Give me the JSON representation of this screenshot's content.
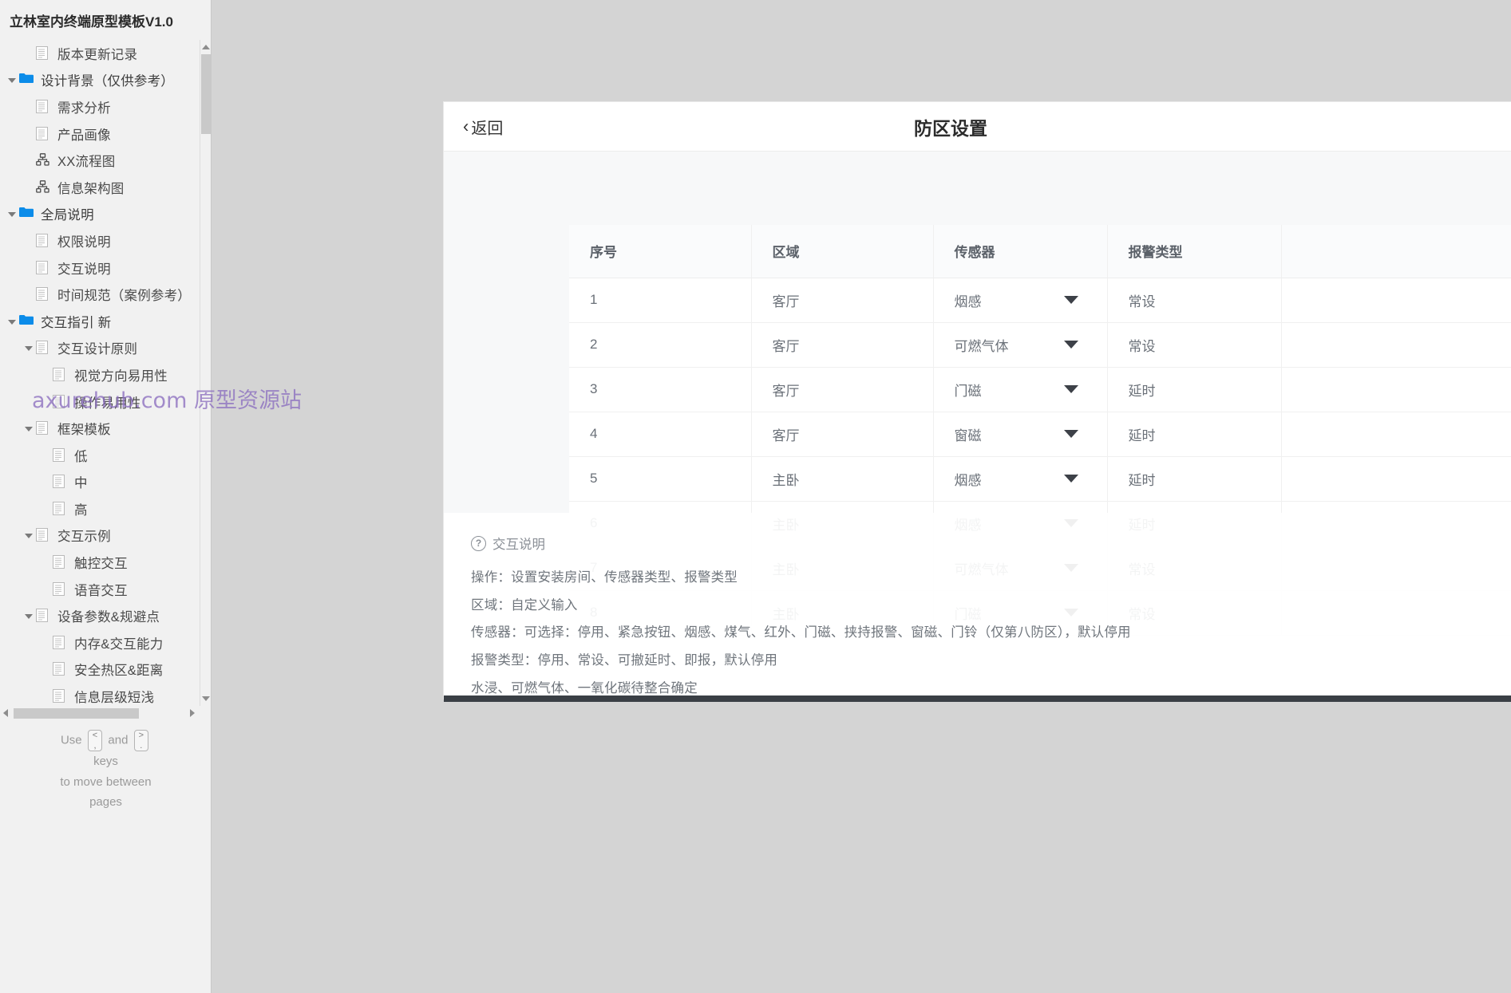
{
  "sidebar": {
    "title": "立林室内终端原型模板V1.0",
    "tree": [
      {
        "label": "版本更新记录",
        "icon": "page-icon",
        "indent": 1,
        "arrow": "none"
      },
      {
        "label": "设计背景（仅供参考）",
        "icon": "folder-icon",
        "indent": 0,
        "arrow": "open"
      },
      {
        "label": "需求分析",
        "icon": "page-icon",
        "indent": 1,
        "arrow": "none"
      },
      {
        "label": "产品画像",
        "icon": "page-icon",
        "indent": 1,
        "arrow": "none"
      },
      {
        "label": "XX流程图",
        "icon": "flow-icon",
        "indent": 1,
        "arrow": "none"
      },
      {
        "label": "信息架构图",
        "icon": "flow-icon",
        "indent": 1,
        "arrow": "none"
      },
      {
        "label": "全局说明",
        "icon": "folder-icon",
        "indent": 0,
        "arrow": "open"
      },
      {
        "label": "权限说明",
        "icon": "page-icon",
        "indent": 1,
        "arrow": "none"
      },
      {
        "label": "交互说明",
        "icon": "page-icon",
        "indent": 1,
        "arrow": "none"
      },
      {
        "label": "时间规范（案例参考）",
        "icon": "page-icon",
        "indent": 1,
        "arrow": "none"
      },
      {
        "label": "交互指引 新",
        "icon": "folder-icon",
        "indent": 0,
        "arrow": "open"
      },
      {
        "label": "交互设计原则",
        "icon": "page-icon",
        "indent": 1,
        "arrow": "open"
      },
      {
        "label": "视觉方向易用性",
        "icon": "page-icon",
        "indent": 2,
        "arrow": "none"
      },
      {
        "label": "操作易用性",
        "icon": "page-icon",
        "indent": 2,
        "arrow": "none"
      },
      {
        "label": "框架模板",
        "icon": "page-icon",
        "indent": 1,
        "arrow": "open"
      },
      {
        "label": "低",
        "icon": "page-icon",
        "indent": 2,
        "arrow": "none"
      },
      {
        "label": "中",
        "icon": "page-icon",
        "indent": 2,
        "arrow": "none"
      },
      {
        "label": "高",
        "icon": "page-icon",
        "indent": 2,
        "arrow": "none"
      },
      {
        "label": "交互示例",
        "icon": "page-icon",
        "indent": 1,
        "arrow": "open"
      },
      {
        "label": "触控交互",
        "icon": "page-icon",
        "indent": 2,
        "arrow": "none"
      },
      {
        "label": "语音交互",
        "icon": "page-icon",
        "indent": 2,
        "arrow": "none"
      },
      {
        "label": "设备参数&规避点",
        "icon": "page-icon",
        "indent": 1,
        "arrow": "open"
      },
      {
        "label": "内存&交互能力",
        "icon": "page-icon",
        "indent": 2,
        "arrow": "none"
      },
      {
        "label": "安全热区&距离",
        "icon": "page-icon",
        "indent": 2,
        "arrow": "none"
      },
      {
        "label": "信息层级短浅",
        "icon": "page-icon",
        "indent": 2,
        "arrow": "none"
      }
    ],
    "page_hint": {
      "use": "Use",
      "key_prev": "<",
      "key_prev_sub": ",",
      "and": "and",
      "key_next": ">",
      "key_next_sub": ".",
      "keys_word": "keys",
      "line2": "to move between",
      "line3": "pages"
    }
  },
  "watermark": "axurehub.com 原型资源站",
  "device": {
    "topbar": {
      "back_label": "返回",
      "back_chevron": "‹",
      "title": "防区设置"
    },
    "table": {
      "columns": [
        "序号",
        "区域",
        "传感器",
        "报警类型"
      ],
      "rows": [
        {
          "idx": "1",
          "area": "客厅",
          "sensor": "烟感",
          "alarm": "常设"
        },
        {
          "idx": "2",
          "area": "客厅",
          "sensor": "可燃气体",
          "alarm": "常设"
        },
        {
          "idx": "3",
          "area": "客厅",
          "sensor": "门磁",
          "alarm": "延时"
        },
        {
          "idx": "4",
          "area": "客厅",
          "sensor": "窗磁",
          "alarm": "延时"
        },
        {
          "idx": "5",
          "area": "主卧",
          "sensor": "烟感",
          "alarm": "延时"
        },
        {
          "idx": "6",
          "area": "主卧",
          "sensor": "烟感",
          "alarm": "延时"
        },
        {
          "idx": "7",
          "area": "主卧",
          "sensor": "可燃气体",
          "alarm": "常设"
        },
        {
          "idx": "8",
          "area": "主卧",
          "sensor": "门磁",
          "alarm": "常设"
        }
      ]
    }
  },
  "note": {
    "icon_glyph": "?",
    "title": "交互说明",
    "lines": [
      "操作：设置安装房间、传感器类型、报警类型",
      "区域：自定义输入",
      "传感器：可选择：停用、紧急按钮、烟感、煤气、红外、门磁、挟持报警、窗磁、门铃（仅第八防区），默认停用",
      "报警类型：停用、常设、可撤延时、即报，默认停用",
      "水浸、可燃气体、一氧化碳待整合确定"
    ]
  }
}
